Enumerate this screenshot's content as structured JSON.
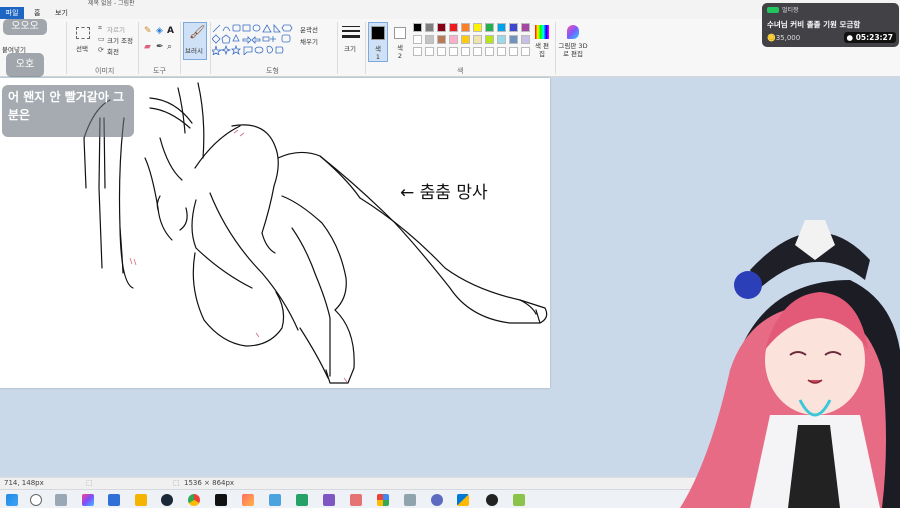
{
  "menu": {
    "file": "파일",
    "home": "홈",
    "view": "보기"
  },
  "clipboard": {
    "paste_label": "붙여넣기"
  },
  "image": {
    "select_label": "선택",
    "crop_label": "자르기",
    "resize_label": "크기 조정",
    "rotate_label": "회전",
    "group_label": "이미지"
  },
  "tools": {
    "group_label": "도구"
  },
  "brushes": {
    "label": "브러시"
  },
  "shapes": {
    "outline_label": "윤곽선",
    "fill_label": "채우기",
    "group_label": "도형"
  },
  "size": {
    "label": "크기"
  },
  "colors": {
    "color1_label": "색 1",
    "color2_label": "색 2",
    "edit_label": "색 편집",
    "group_label": "색",
    "palette": [
      "#000000",
      "#7f7f7f",
      "#880015",
      "#ed1c24",
      "#ff7f27",
      "#fff200",
      "#22b14c",
      "#00a2e8",
      "#3f48cc",
      "#a349a4",
      "#ffffff",
      "#c3c3c3",
      "#b97a57",
      "#ffaec9",
      "#ffc90e",
      "#efe4b0",
      "#b5e61d",
      "#99d9ea",
      "#7092be",
      "#c8bfe7"
    ]
  },
  "paint3d": {
    "label": "그림판 3D로 편집"
  },
  "status": {
    "position": "714, 148px",
    "size": "1536 × 864px"
  },
  "canvas": {
    "annotation": "← 춤춤 망사"
  },
  "overlay": {
    "chip1": "오오오",
    "chip2": "오호",
    "caption": "어 왠지 안 빨거같아 그 분은"
  },
  "donation": {
    "user": "멀티짱",
    "title": "수녀님 커비 졸졸 기원 모금함",
    "amount": "35,000",
    "timer": "05:23:27",
    "badge_color": "#22c55e"
  }
}
